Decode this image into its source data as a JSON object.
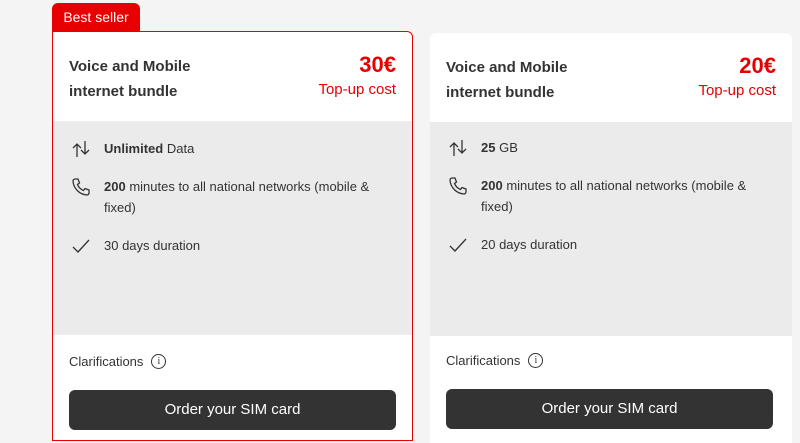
{
  "badge": "Best seller",
  "plans": [
    {
      "title_line1": "Voice and Mobile",
      "title_line2": "internet bundle",
      "price": "30€",
      "price_label": "Top-up cost",
      "data_bold": "Unlimited",
      "data_rest": " Data",
      "minutes_bold": "200",
      "minutes_rest": " minutes to all national networks (mobile & fixed)",
      "duration": "30 days duration",
      "clarifications": "Clarifications",
      "order": "Order your SIM card"
    },
    {
      "title_line1": "Voice and Mobile",
      "title_line2": "internet bundle",
      "price": "20€",
      "price_label": "Top-up cost",
      "data_bold": "25",
      "data_rest": " GB",
      "minutes_bold": "200",
      "minutes_rest": " minutes to all national networks (mobile & fixed)",
      "duration": "20 days duration",
      "clarifications": "Clarifications",
      "order": "Order your SIM card"
    }
  ],
  "icons": {
    "data": "data-transfer-icon",
    "phone": "phone-icon",
    "check": "check-icon",
    "info": "info-icon"
  },
  "colors": {
    "accent": "#e60000",
    "button": "#333333",
    "feature_bg": "#ebebeb"
  }
}
